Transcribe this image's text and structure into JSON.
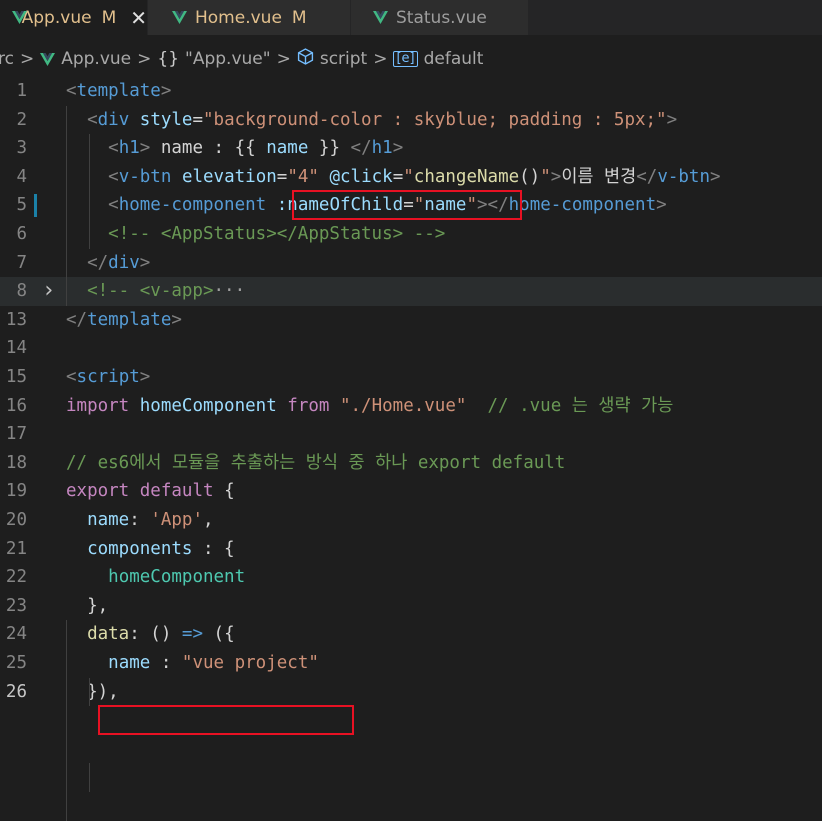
{
  "tabs": [
    {
      "label": "App.vue",
      "badge": "M",
      "close": "✕"
    },
    {
      "label": "Home.vue",
      "badge": "M"
    },
    {
      "label": "Status.vue"
    }
  ],
  "breadcrumb": {
    "folder": "rc",
    "file": "App.vue",
    "module": "\"App.vue\"",
    "section": "script",
    "symbol": "default"
  },
  "colors": {
    "vue_green": "#41b883",
    "highlight": "#e81123",
    "modified": "#e2c08d"
  },
  "icons": [
    "vue-logo-icon",
    "close-icon",
    "chevron-right-icon",
    "braces-icon",
    "cube-icon",
    "field-icon",
    "fold-chevron-icon"
  ],
  "lines": [
    {
      "num": "1",
      "tokens": [
        [
          "punc",
          "<"
        ],
        [
          "tag",
          "template"
        ],
        [
          "punc",
          ">"
        ]
      ]
    },
    {
      "num": "2",
      "tokens": [
        [
          "txt",
          "  "
        ],
        [
          "punc",
          "<"
        ],
        [
          "tag",
          "div"
        ],
        [
          "txt",
          " "
        ],
        [
          "attr",
          "style"
        ],
        [
          "txt",
          "="
        ],
        [
          "str",
          "\"background-color : skyblue; padding : 5px;\""
        ],
        [
          "punc",
          ">"
        ]
      ]
    },
    {
      "num": "3",
      "tokens": [
        [
          "txt",
          "    "
        ],
        [
          "punc",
          "<"
        ],
        [
          "tag",
          "h1"
        ],
        [
          "punc",
          ">"
        ],
        [
          "txt",
          " name : {{ "
        ],
        [
          "id",
          "name"
        ],
        [
          "txt",
          " }} "
        ],
        [
          "punc",
          "</"
        ],
        [
          "tag",
          "h1"
        ],
        [
          "punc",
          ">"
        ]
      ]
    },
    {
      "num": "4",
      "tokens": [
        [
          "txt",
          "    "
        ],
        [
          "punc",
          "<"
        ],
        [
          "tag",
          "v-btn"
        ],
        [
          "txt",
          " "
        ],
        [
          "attr",
          "elevation"
        ],
        [
          "txt",
          "="
        ],
        [
          "str",
          "\"4\""
        ],
        [
          "txt",
          " "
        ],
        [
          "attr",
          "@click"
        ],
        [
          "txt",
          "="
        ],
        [
          "str",
          "\""
        ],
        [
          "fn",
          "changeName"
        ],
        [
          "txt",
          "()"
        ],
        [
          "str",
          "\""
        ],
        [
          "punc",
          ">"
        ],
        [
          "txt",
          "이름 변경"
        ],
        [
          "punc",
          "</"
        ],
        [
          "tag",
          "v-btn"
        ],
        [
          "punc",
          ">"
        ]
      ]
    },
    {
      "num": "5",
      "tokens": [
        [
          "txt",
          "    "
        ],
        [
          "punc",
          "<"
        ],
        [
          "tag",
          "home-component"
        ],
        [
          "txt",
          " "
        ],
        [
          "attr",
          ":nameOfChild"
        ],
        [
          "txt",
          "="
        ],
        [
          "str",
          "\""
        ],
        [
          "id",
          "name"
        ],
        [
          "str",
          "\""
        ],
        [
          "punc",
          ">"
        ],
        [
          "punc",
          "</"
        ],
        [
          "tag",
          "home-component"
        ],
        [
          "punc",
          ">"
        ]
      ]
    },
    {
      "num": "6",
      "tokens": [
        [
          "txt",
          "    "
        ],
        [
          "cm",
          "<!-- <AppStatus></AppStatus> -->"
        ]
      ]
    },
    {
      "num": "7",
      "tokens": [
        [
          "txt",
          "  "
        ],
        [
          "punc",
          "</"
        ],
        [
          "tag",
          "div"
        ],
        [
          "punc",
          ">"
        ]
      ]
    },
    {
      "num": "8",
      "tokens": [
        [
          "txt",
          "  "
        ],
        [
          "cm",
          "<!-- <v-app>"
        ],
        [
          "dots",
          "···"
        ]
      ]
    },
    {
      "num": "13",
      "tokens": [
        [
          "punc",
          "</"
        ],
        [
          "tag",
          "template"
        ],
        [
          "punc",
          ">"
        ]
      ]
    },
    {
      "num": "14",
      "tokens": []
    },
    {
      "num": "15",
      "tokens": [
        [
          "punc",
          "<"
        ],
        [
          "tag",
          "script"
        ],
        [
          "punc",
          ">"
        ]
      ]
    },
    {
      "num": "16",
      "tokens": [
        [
          "kw",
          "import"
        ],
        [
          "txt",
          " "
        ],
        [
          "id",
          "homeComponent"
        ],
        [
          "txt",
          " "
        ],
        [
          "kw",
          "from"
        ],
        [
          "txt",
          " "
        ],
        [
          "str",
          "\"./Home.vue\""
        ],
        [
          "txt",
          "  "
        ],
        [
          "cm",
          "// .vue 는 생략 가능"
        ]
      ]
    },
    {
      "num": "17",
      "tokens": []
    },
    {
      "num": "18",
      "tokens": [
        [
          "cm",
          "// es6에서 모듈을 추출하는 방식 중 하나 export default"
        ]
      ]
    },
    {
      "num": "19",
      "tokens": [
        [
          "kw",
          "export"
        ],
        [
          "txt",
          " "
        ],
        [
          "kw",
          "default"
        ],
        [
          "txt",
          " {"
        ]
      ]
    },
    {
      "num": "20",
      "tokens": [
        [
          "txt",
          "  "
        ],
        [
          "id",
          "name"
        ],
        [
          "txt",
          ": "
        ],
        [
          "str",
          "'App'"
        ],
        [
          "txt",
          ","
        ]
      ]
    },
    {
      "num": "21",
      "tokens": [
        [
          "txt",
          "  "
        ],
        [
          "id",
          "components"
        ],
        [
          "txt",
          " : {"
        ]
      ]
    },
    {
      "num": "22",
      "tokens": [
        [
          "txt",
          "    "
        ],
        [
          "cls",
          "homeComponent"
        ]
      ]
    },
    {
      "num": "23",
      "tokens": [
        [
          "txt",
          "  },"
        ]
      ]
    },
    {
      "num": "24",
      "tokens": [
        [
          "txt",
          "  "
        ],
        [
          "fn",
          "data"
        ],
        [
          "txt",
          ": () "
        ],
        [
          "arrow",
          "=>"
        ],
        [
          "txt",
          " ({"
        ]
      ]
    },
    {
      "num": "25",
      "tokens": [
        [
          "txt",
          "    "
        ],
        [
          "id",
          "name"
        ],
        [
          "txt",
          " : "
        ],
        [
          "str",
          "\"vue project\""
        ]
      ]
    },
    {
      "num": "26",
      "tokens": [
        [
          "txt",
          "  }),"
        ]
      ]
    }
  ]
}
